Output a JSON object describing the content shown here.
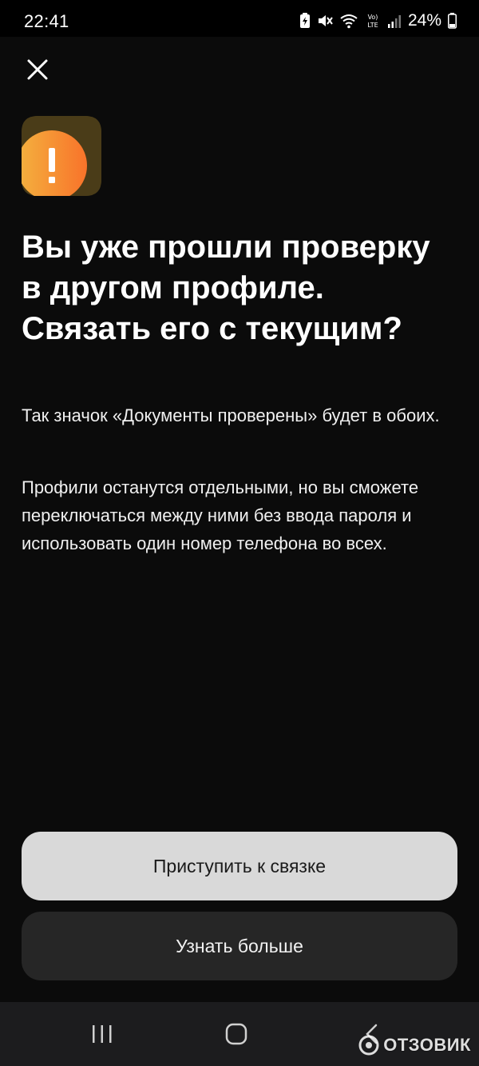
{
  "status_bar": {
    "time": "22:41",
    "battery": "24%",
    "icons": [
      "battery-saver-icon",
      "mute-icon",
      "wifi-icon",
      "volte-icon",
      "signal-icon",
      "battery-icon"
    ]
  },
  "header": {
    "close_icon": "close-icon"
  },
  "alert": {
    "icon": "exclamation-icon",
    "colors": {
      "gradient_start": "#f4b23f",
      "gradient_end": "#f8732a",
      "shadow": "#5a4a1e"
    }
  },
  "content": {
    "title": "Вы уже прошли проверку в другом профиле. Связать его с текущим?",
    "paragraph_1": "Так значок «Документы проверены» будет в обоих.",
    "paragraph_2": "Профили останутся отдельными, но вы сможете переключаться между ними без ввода пароля и использовать один номер телефона во всех."
  },
  "actions": {
    "primary_label": "Приступить к связке",
    "secondary_label": "Узнать больше"
  },
  "nav_bar": {
    "icons": [
      "recent-apps-icon",
      "home-icon",
      "back-icon"
    ]
  },
  "watermark": {
    "text": "ОТЗОВИК"
  }
}
